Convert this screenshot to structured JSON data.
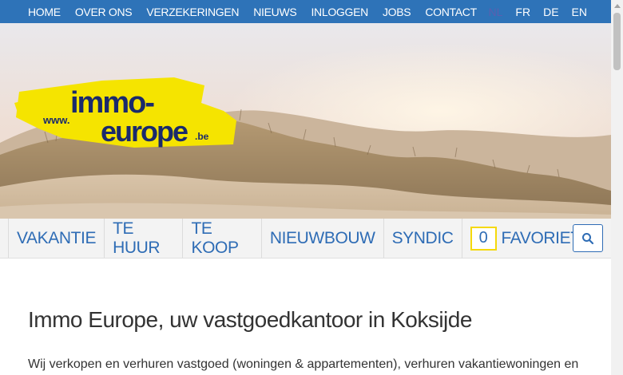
{
  "topnav": {
    "items": [
      "HOME",
      "OVER ONS",
      "VERZEKERINGEN",
      "NIEUWS",
      "INLOGGEN",
      "JOBS",
      "CONTACT"
    ],
    "languages": [
      {
        "code": "NL",
        "active": true
      },
      {
        "code": "FR",
        "active": false
      },
      {
        "code": "DE",
        "active": false
      },
      {
        "code": "EN",
        "active": false
      }
    ],
    "bg_color": "#2e73b8"
  },
  "logo": {
    "prefix": "www.",
    "line1": "immo-",
    "line2": "europe",
    "suffix": ".be",
    "color": "#f5e400"
  },
  "categories": {
    "items": [
      "VAKANTIE",
      "TE HUUR",
      "TE KOOP",
      "NIEUWBOUW",
      "SYNDIC"
    ],
    "favorites_count": "0",
    "favorites_label": "FAVORIETEN",
    "accent": "#2e6cb5",
    "highlight": "#f5d90a"
  },
  "search": {
    "icon": "search-icon"
  },
  "content": {
    "heading": "Immo Europe, uw vastgoedkantoor in Koksijde",
    "intro": "Wij verkopen en verhuren vastgoed (woningen & appartementen), verhuren vakantiewoningen en"
  }
}
